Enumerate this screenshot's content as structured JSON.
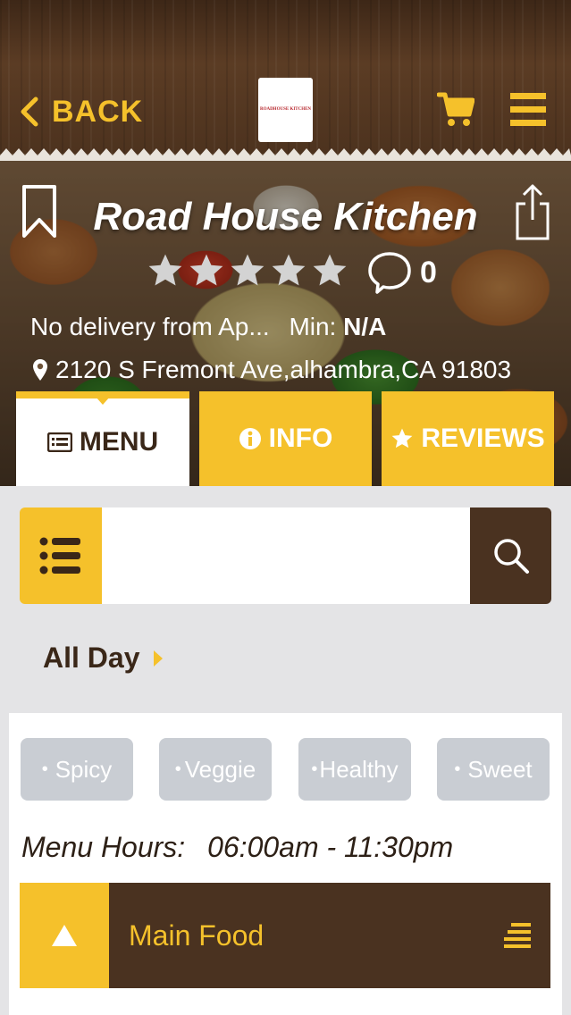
{
  "header": {
    "back_label": "BACK",
    "logo_text": "ROADHOUSE KITCHEN",
    "accent_color": "#f5c12b",
    "brown_color": "#4a3220",
    "cart_icon": "cart-icon",
    "menu_icon": "hamburger-icon"
  },
  "restaurant": {
    "name": "Road House Kitchen",
    "rating": 0,
    "max_rating": 5,
    "review_count": "0",
    "delivery_text": "No delivery from Ap...",
    "min_label": "Min:",
    "min_value": "N/A",
    "address": "2120 S Fremont Ave,alhambra,CA 91803"
  },
  "tabs": [
    {
      "label": "MENU",
      "icon": "list-icon",
      "active": true
    },
    {
      "label": "INFO",
      "icon": "info-icon",
      "active": false
    },
    {
      "label": "REVIEWS",
      "icon": "star-icon",
      "active": false
    }
  ],
  "search": {
    "value": "",
    "placeholder": ""
  },
  "menu_period": "All Day",
  "tags": [
    "Spicy",
    "Veggie",
    "Healthy",
    "Sweet"
  ],
  "tag_bullet": "•",
  "hours_label": "Menu Hours:",
  "hours_value": "06:00am - 11:30pm",
  "categories": [
    {
      "name": "Main Food",
      "expanded": true
    }
  ]
}
